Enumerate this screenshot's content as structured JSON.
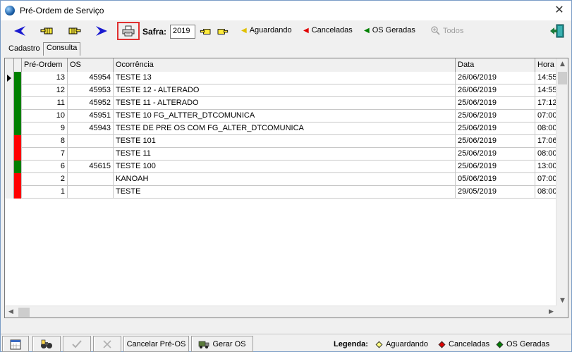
{
  "window": {
    "title": "Pré-Ordem de Serviço",
    "close": "✕"
  },
  "toolbar": {
    "safra_label": "Safra:",
    "safra_value": "2019",
    "filters": {
      "aguardando": "Aguardando",
      "canceladas": "Canceladas",
      "geradas": "OS Geradas",
      "todos": "Todos"
    }
  },
  "tabs": {
    "cadastro": "Cadastro",
    "consulta": "Consulta"
  },
  "grid": {
    "columns": [
      "Pré-Ordem",
      "OS",
      "Ocorrência",
      "Data",
      "Hora"
    ],
    "rows": [
      {
        "pre_ordem": "13",
        "os": "45954",
        "ocorrencia": "TESTE 13",
        "data": "26/06/2019",
        "hora": "14:55",
        "status": "green"
      },
      {
        "pre_ordem": "12",
        "os": "45953",
        "ocorrencia": "TESTE 12 - ALTERADO",
        "data": "26/06/2019",
        "hora": "14:55",
        "status": "green"
      },
      {
        "pre_ordem": "11",
        "os": "45952",
        "ocorrencia": "TESTE 11 - ALTERADO",
        "data": "25/06/2019",
        "hora": "17:12",
        "status": "green"
      },
      {
        "pre_ordem": "10",
        "os": "45951",
        "ocorrencia": "TESTE 10 FG_ALTTER_DTCOMUNICA",
        "data": "25/06/2019",
        "hora": "07:00",
        "status": "green"
      },
      {
        "pre_ordem": "9",
        "os": "45943",
        "ocorrencia": "TESTE DE PRE OS COM FG_ALTER_DTCOMUNICA",
        "data": "25/06/2019",
        "hora": "08:00",
        "status": "green"
      },
      {
        "pre_ordem": "8",
        "os": "",
        "ocorrencia": "TESTE 101",
        "data": "25/06/2019",
        "hora": "17:06",
        "status": "red"
      },
      {
        "pre_ordem": "7",
        "os": "",
        "ocorrencia": "TESTE 11",
        "data": "25/06/2019",
        "hora": "08:00",
        "status": "red"
      },
      {
        "pre_ordem": "6",
        "os": "45615",
        "ocorrencia": "TESTE 100",
        "data": "25/06/2019",
        "hora": "13:00",
        "status": "green"
      },
      {
        "pre_ordem": "2",
        "os": "",
        "ocorrencia": "KANOAH",
        "data": "05/06/2019",
        "hora": "07:00",
        "status": "red"
      },
      {
        "pre_ordem": "1",
        "os": "",
        "ocorrencia": "TESTE",
        "data": "29/05/2019",
        "hora": "08:00",
        "status": "red"
      }
    ]
  },
  "bottom": {
    "cancelar_label": "Cancelar Pré-OS",
    "gerar_label": "Gerar OS",
    "legend_title": "Legenda:",
    "legend": {
      "aguardando": "Aguardando",
      "canceladas": "Canceladas",
      "geradas": "OS Geradas"
    }
  },
  "colors": {
    "green": "#008000",
    "red": "#ff0000",
    "yellow": "#ffff80",
    "accent_blue": "#1a1ad0"
  }
}
